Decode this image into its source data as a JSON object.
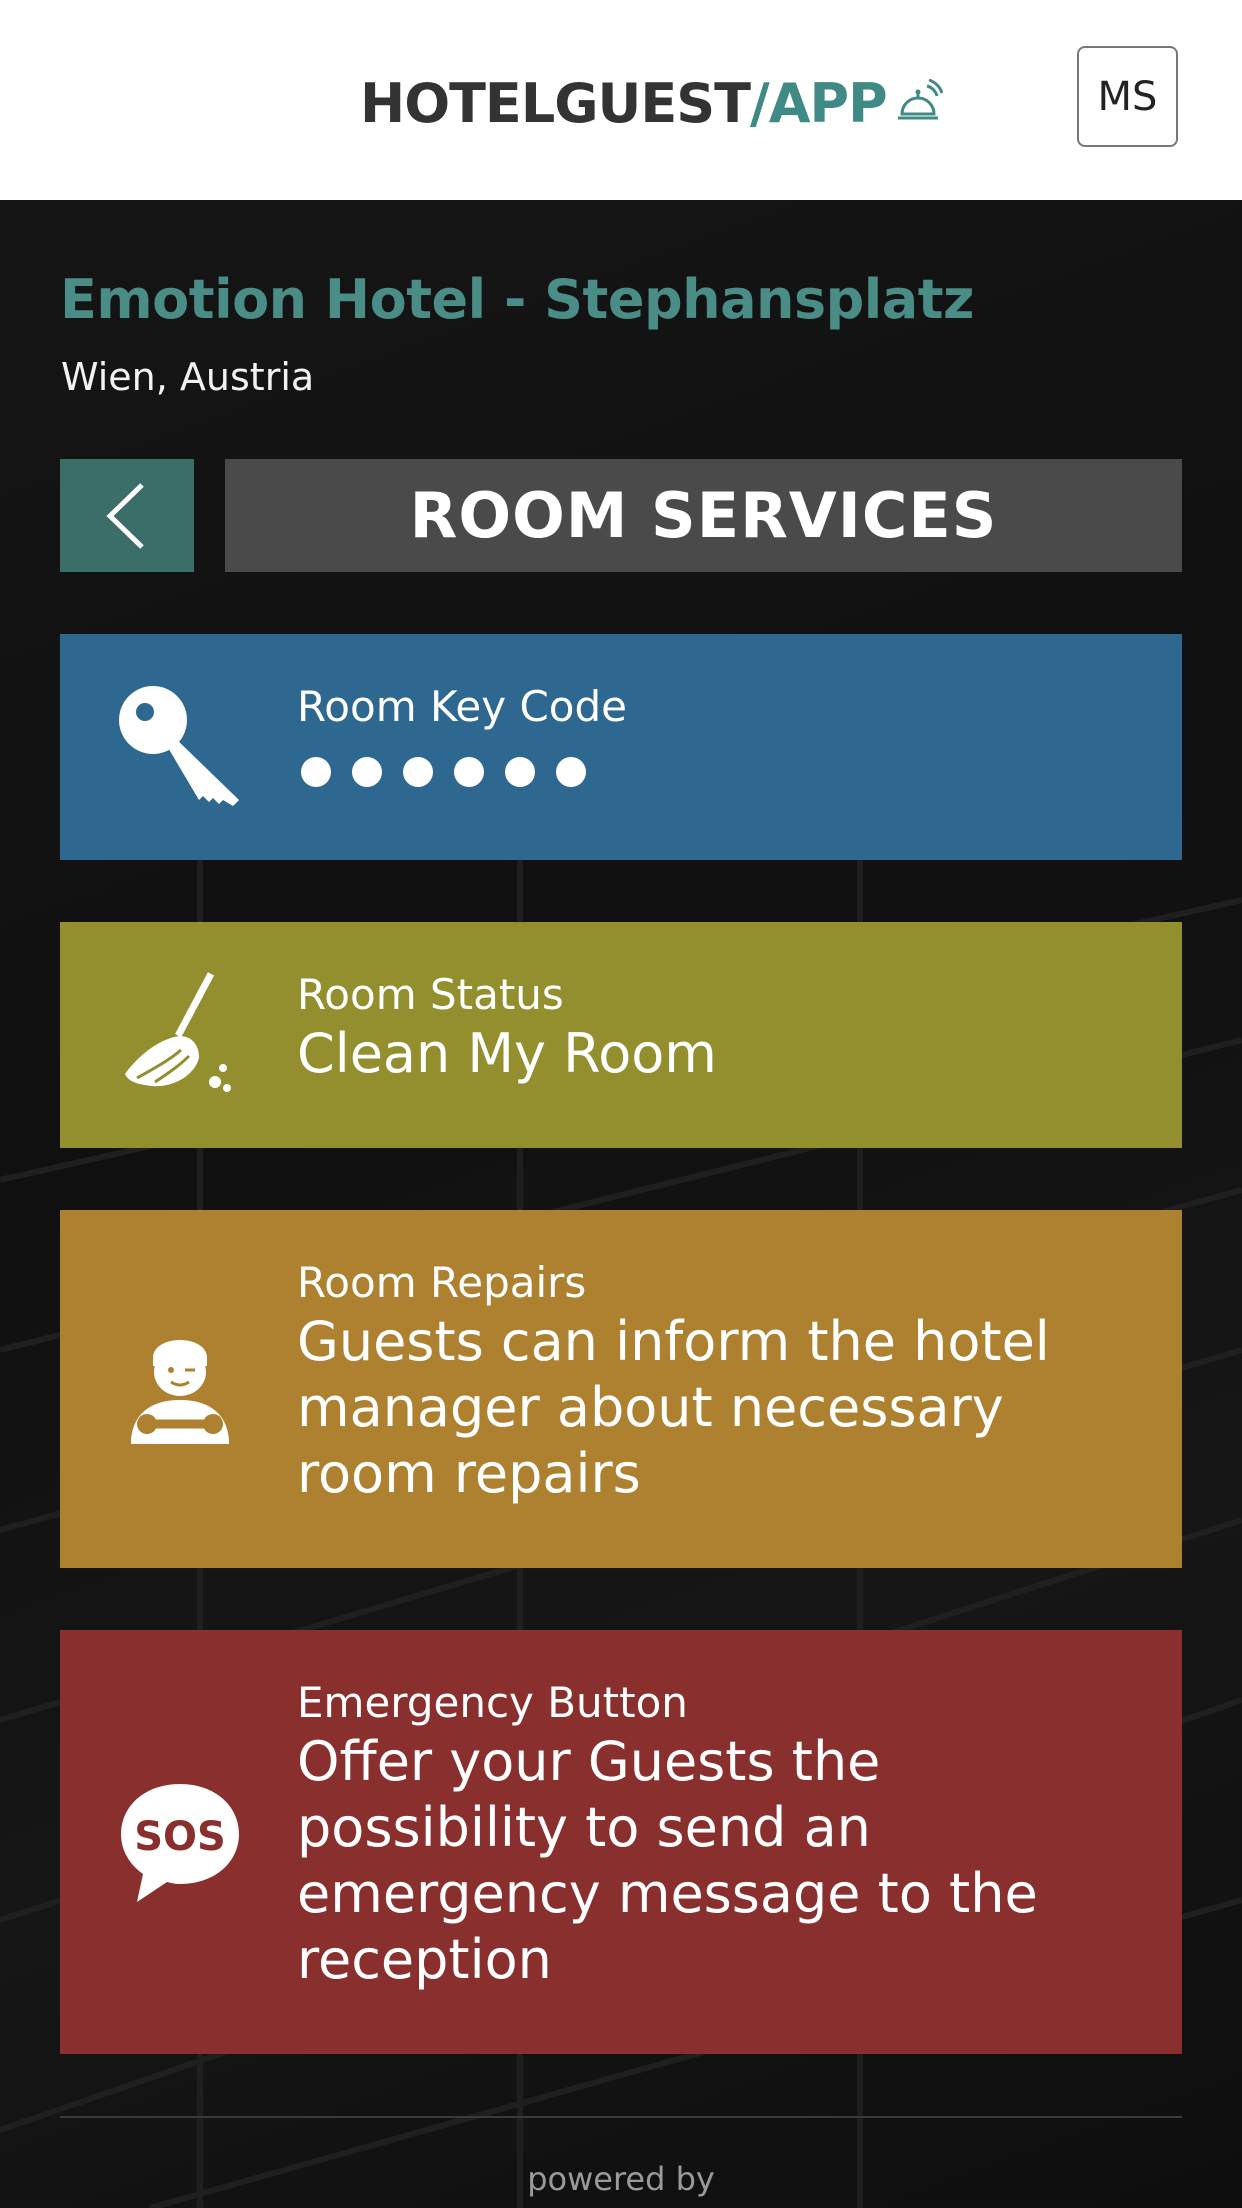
{
  "header": {
    "logo_part1": "HOTELGUEST",
    "logo_part2": "/APP",
    "logo_icon": "service-bell-icon",
    "user_initials": "MS"
  },
  "hotel": {
    "name": "Emotion Hotel - Stephansplatz",
    "location": "Wien, Austria"
  },
  "nav": {
    "back_icon": "chevron-left-icon",
    "title": "ROOM SERVICES"
  },
  "cards": [
    {
      "label": "Room Key Code",
      "value_masked_digits": 6,
      "icon": "key-icon",
      "color": "#2e6890"
    },
    {
      "label": "Room Status",
      "value": "Clean My Room",
      "icon": "broom-icon",
      "color": "#938f2f"
    },
    {
      "label": "Room Repairs",
      "value": "Guests can inform the hotel manager about necessary room repairs",
      "icon": "repairman-icon",
      "color": "#ae8130"
    },
    {
      "label": "Emergency Button",
      "value": "Offer your Guests the possibility to send an emergency message to the reception",
      "icon": "sos-icon",
      "color": "#892f2d"
    }
  ],
  "footer": {
    "powered_by": "powered by"
  },
  "colors": {
    "accent": "#3f8a84",
    "background": "#131313"
  }
}
